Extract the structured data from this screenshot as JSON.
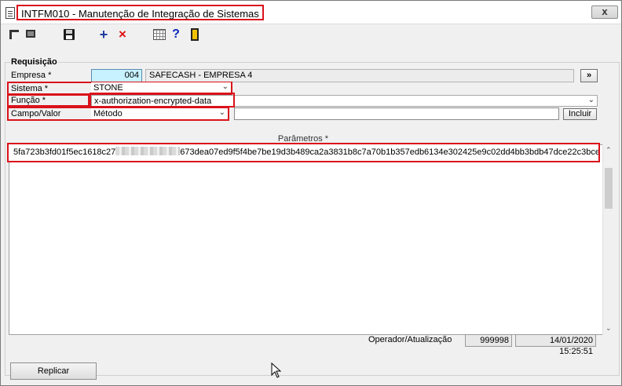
{
  "window": {
    "title": "INTFM010 - Manutenção de Integração de Sistemas",
    "close_label": "x"
  },
  "toolbar": {
    "add_glyph": "+",
    "delete_glyph": "×",
    "help_glyph": "?"
  },
  "form": {
    "group_label": "Requisição",
    "empresa": {
      "label": "Empresa *",
      "code": "004",
      "name": "SAFECASH -  EMPRESA 4",
      "more_button_label": "»"
    },
    "sistema": {
      "label": "Sistema *",
      "value": "STONE"
    },
    "funcao": {
      "label": "Função *",
      "value": "x-authorization-encrypted-data"
    },
    "campo_valor": {
      "label": "Campo/Valor",
      "selected": "Método",
      "value": "",
      "include_button_label": "Incluir"
    },
    "parametros": {
      "header": "Parâmetros *",
      "value_visible_start": "5fa723b3fd01f5ec1618c27",
      "value_visible_end": "673dea07ed9f5f4be7be19d3b489ca2a3831b8c7a70b1b357edb6134e302425e9c02dd4bb3bdb47dce22c3bce"
    },
    "operador": {
      "label": "Operador/Atualização",
      "operator_id": "999998",
      "updated_at": "14/01/2020 15:25:51"
    }
  },
  "footer": {
    "replicar_label": "Replicar"
  },
  "colors": {
    "highlight": "#d9121b",
    "selected_input_bg": "#c8f2ff",
    "window_bg": "#f0f0f0"
  }
}
